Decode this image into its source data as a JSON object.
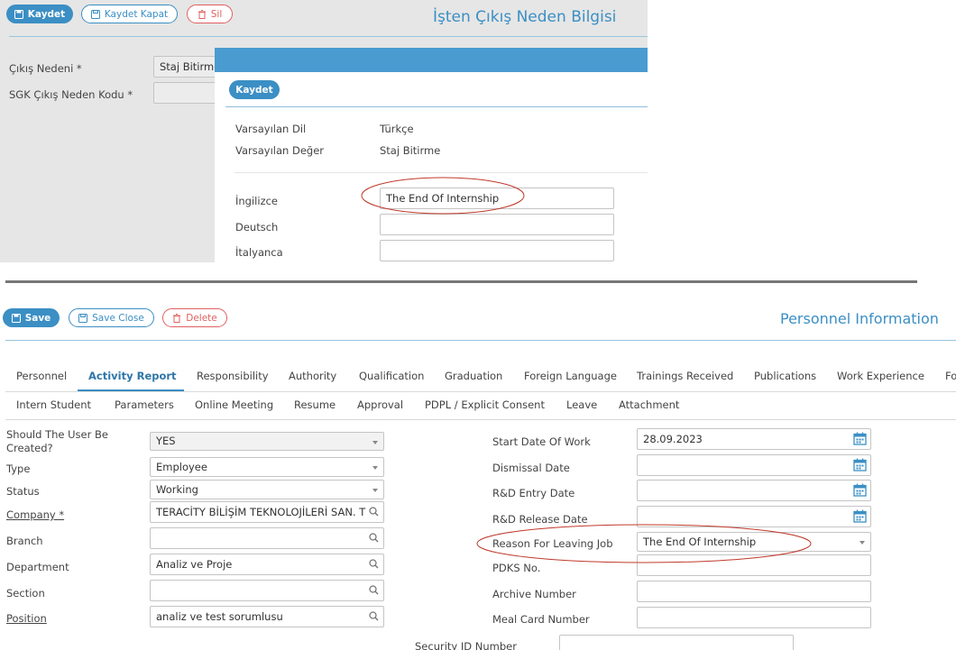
{
  "top": {
    "toolbar": {
      "save": "Kaydet",
      "save_close": "Kaydet Kapat",
      "delete": "Sil"
    },
    "title": "İşten Çıkış Neden Bilgisi",
    "fields": {
      "reason_label": "Çıkış Nedeni *",
      "reason_value": "Staj Bitirme",
      "sgk_label": "SGK Çıkış Neden Kodu *"
    },
    "dialog": {
      "save": "Kaydet",
      "default_lang_label": "Varsayılan Dil",
      "default_lang_value": "Türkçe",
      "default_value_label": "Varsayılan Değer",
      "default_value_value": "Staj Bitirme",
      "translations": [
        {
          "label": "İngilizce",
          "value": "The End Of Internship"
        },
        {
          "label": "Deutsch",
          "value": ""
        },
        {
          "label": "İtalyanca",
          "value": ""
        }
      ]
    }
  },
  "bottom": {
    "toolbar": {
      "save": "Save",
      "save_close": "Save Close",
      "delete": "Delete"
    },
    "title": "Personnel Information",
    "tabs_row1": [
      "Personnel",
      "Activity Report",
      "Responsibility",
      "Authority",
      "Qualification",
      "Graduation",
      "Foreign Language",
      "Trainings Received",
      "Publications",
      "Work Experience",
      "Fo"
    ],
    "tabs_row2": [
      "Intern Student",
      "Parameters",
      "Online Meeting",
      "Resume",
      "Approval",
      "PDPL / Explicit Consent",
      "Leave",
      "Attachment"
    ],
    "active_tab": "Activity Report",
    "left": [
      {
        "label": "Should The User Be Created?",
        "value": "YES"
      },
      {
        "label": "Type",
        "value": "Employee"
      },
      {
        "label": "Status",
        "value": "Working"
      },
      {
        "label": "Company *",
        "value": "TERACİTY BİLİŞİM TEKNOLOJİLERİ SAN. T"
      },
      {
        "label": "Branch",
        "value": ""
      },
      {
        "label": "Department",
        "value": "Analiz ve Proje"
      },
      {
        "label": "Section",
        "value": ""
      },
      {
        "label": "Position",
        "value": "analiz ve test sorumlusu"
      }
    ],
    "right": [
      {
        "label": "Start Date Of Work",
        "value": "28.09.2023"
      },
      {
        "label": "Dismissal Date",
        "value": ""
      },
      {
        "label": "R&D Entry Date",
        "value": ""
      },
      {
        "label": "R&D Release Date",
        "value": ""
      },
      {
        "label": "Reason For Leaving Job",
        "value": "The End Of Internship"
      },
      {
        "label": "PDKS No.",
        "value": ""
      },
      {
        "label": "Archive Number",
        "value": ""
      },
      {
        "label": "Meal Card Number",
        "value": ""
      }
    ],
    "partial_label": "Security ID Number"
  },
  "colors": {
    "accent": "#3b8fc4",
    "danger": "#e06060",
    "annotation": "#c0392b",
    "divider": "#777777"
  }
}
